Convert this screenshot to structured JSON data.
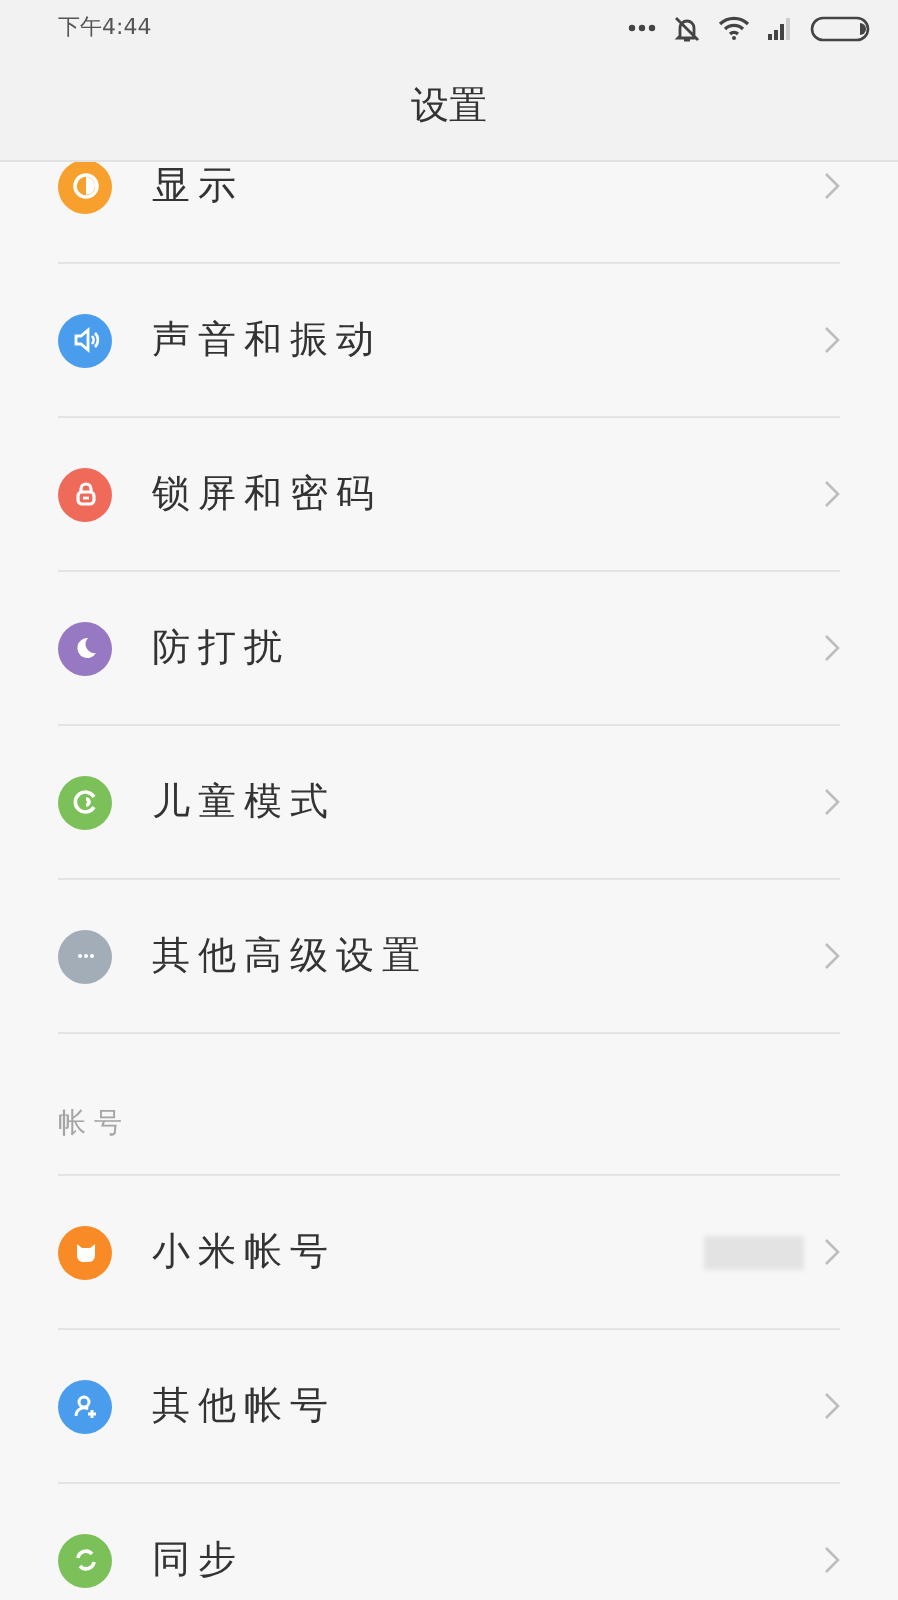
{
  "status_bar": {
    "time": "下午4:44"
  },
  "title": "设置",
  "sections": [
    {
      "items": [
        {
          "label": "显示",
          "color": "#f7a02d",
          "redacted": false
        },
        {
          "label": "声音和振动",
          "color": "#4a9ded",
          "redacted": false
        },
        {
          "label": "锁屏和密码",
          "color": "#f06a5a",
          "redacted": false
        },
        {
          "label": "防打扰",
          "color": "#9778c2",
          "redacted": false
        },
        {
          "label": "儿童模式",
          "color": "#7cc05a",
          "redacted": false
        },
        {
          "label": "其他高级设置",
          "color": "#a3adb8",
          "redacted": false
        }
      ]
    },
    {
      "header": "帐号",
      "items": [
        {
          "label": "小米帐号",
          "color": "#f98b26",
          "redacted": true
        },
        {
          "label": "其他帐号",
          "color": "#4a9ded",
          "redacted": false
        },
        {
          "label": "同步",
          "color": "#7cc05a",
          "redacted": false
        }
      ]
    }
  ]
}
